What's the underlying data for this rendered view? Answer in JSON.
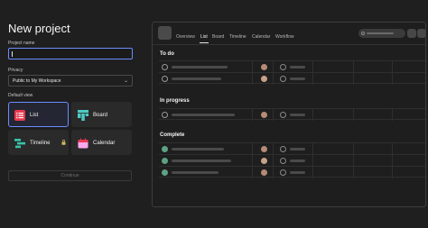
{
  "page_title": "New project",
  "form": {
    "project_name_label": "Project name",
    "project_name_value": "",
    "privacy_label": "Privacy",
    "privacy_value": "Public to My Workspace",
    "default_view_label": "Default view",
    "views": [
      {
        "label": "List",
        "icon": "list-icon",
        "color": "#e8384f",
        "selected": true
      },
      {
        "label": "Board",
        "icon": "board-icon",
        "color": "#4ecbc4",
        "selected": false
      },
      {
        "label": "Timeline",
        "icon": "timeline-icon",
        "color": "#37c5ab",
        "selected": false,
        "badge": "lock-icon"
      },
      {
        "label": "Calendar",
        "icon": "calendar-icon",
        "color": "#f9aaef",
        "selected": false
      }
    ],
    "continue_label": "Continue"
  },
  "preview": {
    "tabs": [
      "Overview",
      "List",
      "Board",
      "Timeline",
      "Calendar",
      "Workflow"
    ],
    "active_tab": "List",
    "sections": [
      {
        "title": "To do",
        "rows": [
          {
            "done": false
          },
          {
            "done": false
          }
        ]
      },
      {
        "title": "In progress",
        "rows": [
          {
            "done": false
          }
        ]
      },
      {
        "title": "Complete",
        "rows": [
          {
            "done": true
          },
          {
            "done": true
          },
          {
            "done": true
          }
        ]
      }
    ],
    "colors": {
      "accent": "#6a8cff",
      "complete": "#5da283"
    }
  }
}
